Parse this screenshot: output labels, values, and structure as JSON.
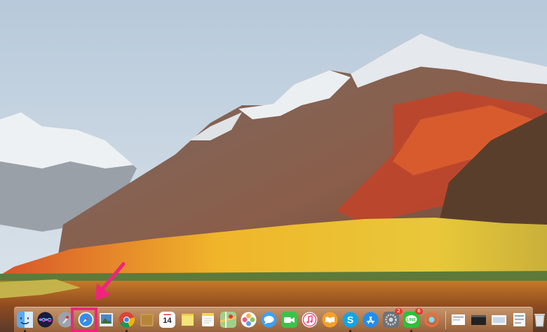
{
  "screen": {
    "wallpaper": "macOS High Sierra mountain landscape",
    "colors": {
      "highlight": "#f0247c",
      "badge": "#e53b2f"
    }
  },
  "dock": {
    "apps": [
      {
        "name": "Finder",
        "icon": "finder-icon",
        "running": true
      },
      {
        "name": "Siri",
        "icon": "siri-icon",
        "running": false
      },
      {
        "name": "Launchpad",
        "icon": "launchpad-icon",
        "running": false
      },
      {
        "name": "Safari",
        "icon": "safari-icon",
        "running": false,
        "highlighted": true
      },
      {
        "name": "Preview",
        "icon": "preview-icon",
        "running": false
      },
      {
        "name": "Google Chrome",
        "icon": "chrome-icon",
        "running": true
      },
      {
        "name": "Notefile",
        "icon": "notefile-icon",
        "running": false
      },
      {
        "name": "Calendar",
        "icon": "calendar-icon",
        "running": false,
        "day": "14"
      },
      {
        "name": "Stickies",
        "icon": "stickies-icon",
        "running": false
      },
      {
        "name": "Notes",
        "icon": "notes-icon",
        "running": false
      },
      {
        "name": "Maps",
        "icon": "maps-icon",
        "running": false
      },
      {
        "name": "Photos",
        "icon": "photos-icon",
        "running": false
      },
      {
        "name": "Messages",
        "icon": "messages-icon",
        "running": false
      },
      {
        "name": "FaceTime",
        "icon": "facetime-icon",
        "running": false
      },
      {
        "name": "iTunes",
        "icon": "itunes-icon",
        "running": false
      },
      {
        "name": "iBooks",
        "icon": "ibooks-icon",
        "running": false
      },
      {
        "name": "Skype",
        "icon": "skype-icon",
        "running": true
      },
      {
        "name": "App Store",
        "icon": "app-store-icon",
        "running": false
      },
      {
        "name": "System Preferences",
        "icon": "system-preferences-icon",
        "running": false,
        "badge": "2"
      },
      {
        "name": "LINE",
        "icon": "line-icon",
        "running": true,
        "badge": "6"
      },
      {
        "name": "Cleaner",
        "icon": "cleaner-icon",
        "running": false
      }
    ],
    "others": [
      {
        "name": "Document",
        "icon": "document-icon"
      },
      {
        "name": "Terminal window",
        "icon": "terminal-window-icon"
      },
      {
        "name": "Screenshot stack",
        "icon": "screenshot-stack-icon"
      },
      {
        "name": "Downloads",
        "icon": "downloads-icon"
      },
      {
        "name": "Trash",
        "icon": "trash-icon"
      }
    ]
  }
}
